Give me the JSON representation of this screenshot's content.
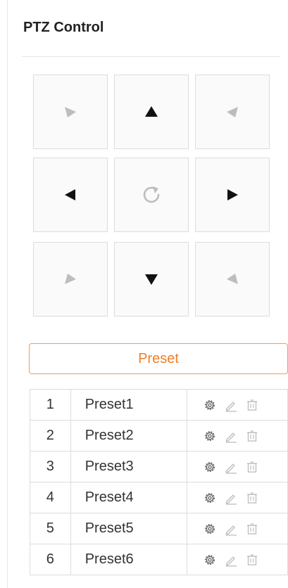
{
  "panel": {
    "title": "PTZ Control"
  },
  "ptz": {
    "buttons": [
      {
        "name": "up-left-icon",
        "state": "disabled"
      },
      {
        "name": "up-icon",
        "state": "enabled"
      },
      {
        "name": "up-right-icon",
        "state": "disabled"
      },
      {
        "name": "left-icon",
        "state": "enabled"
      },
      {
        "name": "reset-icon",
        "state": "disabled"
      },
      {
        "name": "right-icon",
        "state": "enabled"
      },
      {
        "name": "down-left-icon",
        "state": "disabled"
      },
      {
        "name": "down-icon",
        "state": "enabled"
      },
      {
        "name": "down-right-icon",
        "state": "disabled"
      }
    ],
    "colors": {
      "enabled": "#111111",
      "disabled": "#bdbdbd"
    }
  },
  "preset_button": {
    "label": "Preset",
    "color": "#f27d28"
  },
  "presets": [
    {
      "num": "1",
      "name": "Preset1"
    },
    {
      "num": "2",
      "name": "Preset2"
    },
    {
      "num": "3",
      "name": "Preset3"
    },
    {
      "num": "4",
      "name": "Preset4"
    },
    {
      "num": "5",
      "name": "Preset5"
    },
    {
      "num": "6",
      "name": "Preset6"
    }
  ],
  "row_actions": {
    "icons": [
      "gear-icon",
      "edit-icon",
      "delete-icon"
    ]
  }
}
